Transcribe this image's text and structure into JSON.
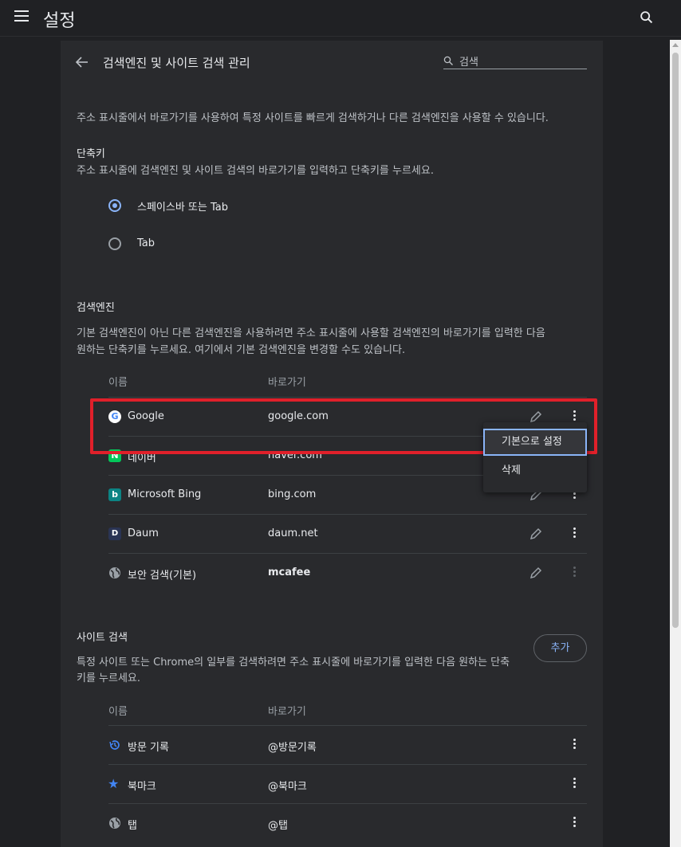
{
  "app": {
    "title": "설정"
  },
  "header": {
    "back_label": "",
    "title": "검색엔진 및 사이트 검색 관리",
    "search_placeholder": "검색"
  },
  "intro": "주소 표시줄에서 바로가기를 사용하여 특정 사이트를 빠르게 검색하거나 다른 검색엔진을 사용할 수 있습니다.",
  "shortcut": {
    "title": "단축키",
    "desc": "주소 표시줄에 검색엔진 및 사이트 검색의 바로가기를 입력하고 단축키를 누르세요.",
    "options": [
      {
        "label": "스페이스바 또는 Tab",
        "selected": true
      },
      {
        "label": "Tab",
        "selected": false
      }
    ]
  },
  "engines": {
    "title": "검색엔진",
    "desc_line1": "기본 검색엔진이 아닌 다른 검색엔진을 사용하려면 주소 표시줄에 사용할 검색엔진의 바로가기를 입력한 다음",
    "desc_line2": "원하는 단축키를 누르세요. 여기에서 기본 검색엔진을 변경할 수도 있습니다.",
    "col_name": "이름",
    "col_shortcut": "바로가기",
    "rows": [
      {
        "name": "Google",
        "shortcut": "google.com",
        "icon": "google-icon"
      },
      {
        "name": "네이버",
        "shortcut": "naver.com",
        "icon": "naver-icon"
      },
      {
        "name": "Microsoft Bing",
        "shortcut": "bing.com",
        "icon": "bing-icon"
      },
      {
        "name": "Daum",
        "shortcut": "daum.net",
        "icon": "daum-icon"
      },
      {
        "name": "보안 검색(기본)",
        "shortcut": "mcafee",
        "icon": "globe-icon"
      }
    ],
    "menu": {
      "set_default": "기본으로 설정",
      "delete": "삭제"
    }
  },
  "site_search": {
    "title": "사이트 검색",
    "desc_line1": "특정 사이트 또는 Chrome의 일부를 검색하려면 주소 표시줄에 바로가기를 입력한 다음 원하는 단축",
    "desc_line2": "키를 누르세요.",
    "add_label": "추가",
    "col_name": "이름",
    "col_shortcut": "바로가기",
    "rows": [
      {
        "name": "방문 기록",
        "shortcut": "@방문기록",
        "icon": "history-icon"
      },
      {
        "name": "북마크",
        "shortcut": "@북마크",
        "icon": "star-icon"
      },
      {
        "name": "탭",
        "shortcut": "@탭",
        "icon": "globe-icon"
      }
    ]
  },
  "colors": {
    "accent": "#8ab4f8",
    "highlight": "#e0202a",
    "background": "#202124",
    "card": "#292a2d"
  }
}
